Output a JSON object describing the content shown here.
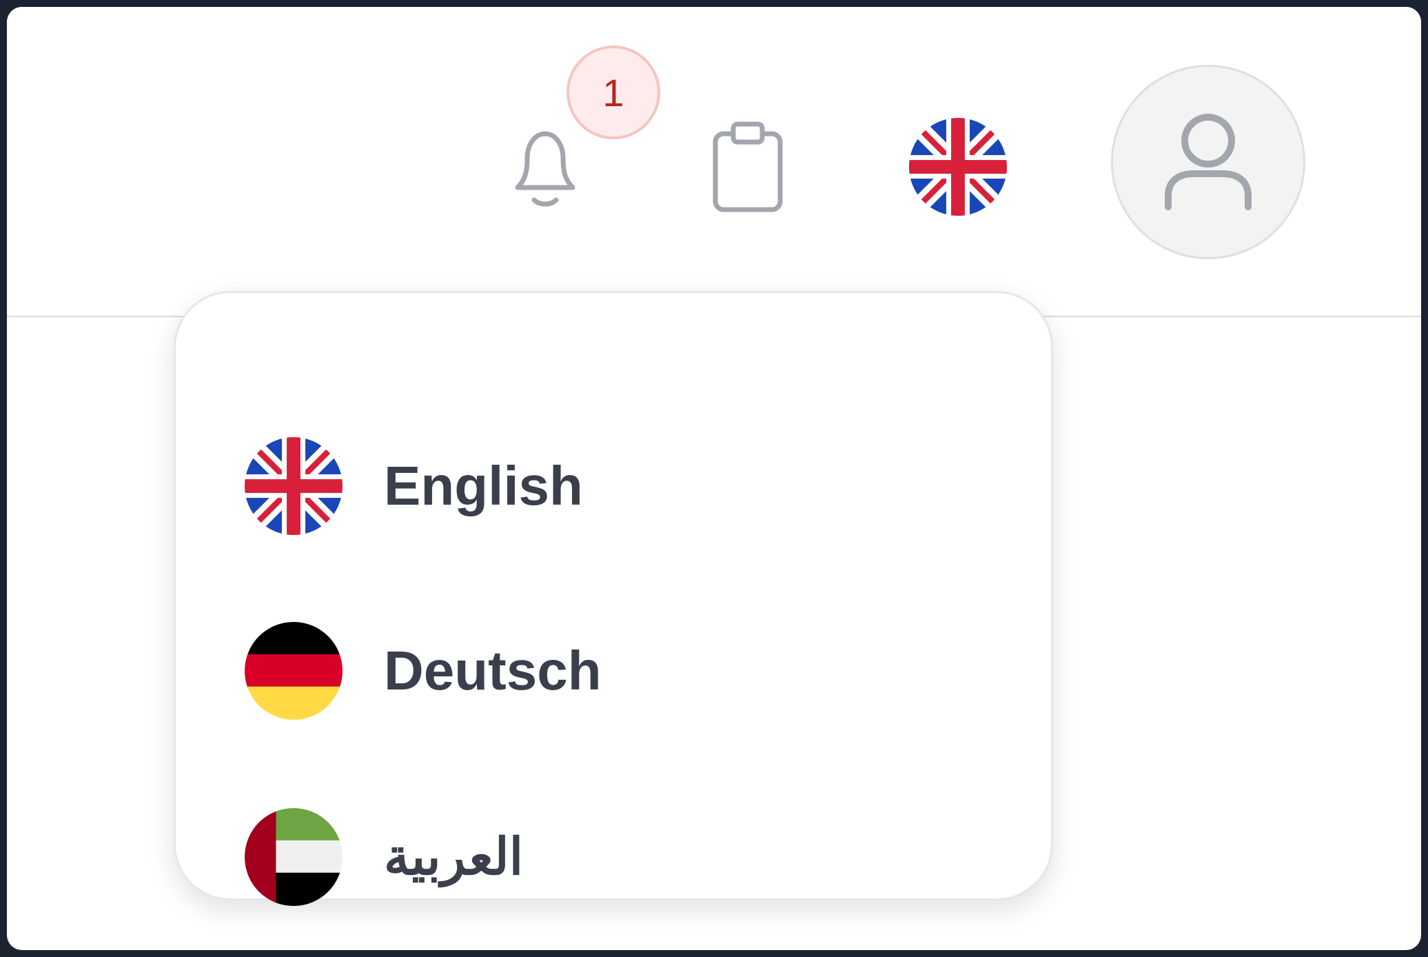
{
  "header": {
    "notifications": {
      "icon": "bell-icon",
      "badge_count": "1"
    },
    "clipboard": {
      "icon": "clipboard-icon"
    },
    "language_selector": {
      "icon": "uk-flag-icon"
    },
    "profile": {
      "icon": "user-icon"
    }
  },
  "language_menu": {
    "items": [
      {
        "label": "English",
        "flag": "uk-flag-icon"
      },
      {
        "label": "Deutsch",
        "flag": "germany-flag-icon"
      },
      {
        "label": "العربية",
        "flag": "uae-flag-icon"
      }
    ]
  },
  "colors": {
    "badge_text": "#b3261e",
    "badge_bg": "#fdeceb",
    "icon_gray": "#a3a6ad",
    "label_text": "#3b3f4b",
    "frame": "#1b2230"
  }
}
